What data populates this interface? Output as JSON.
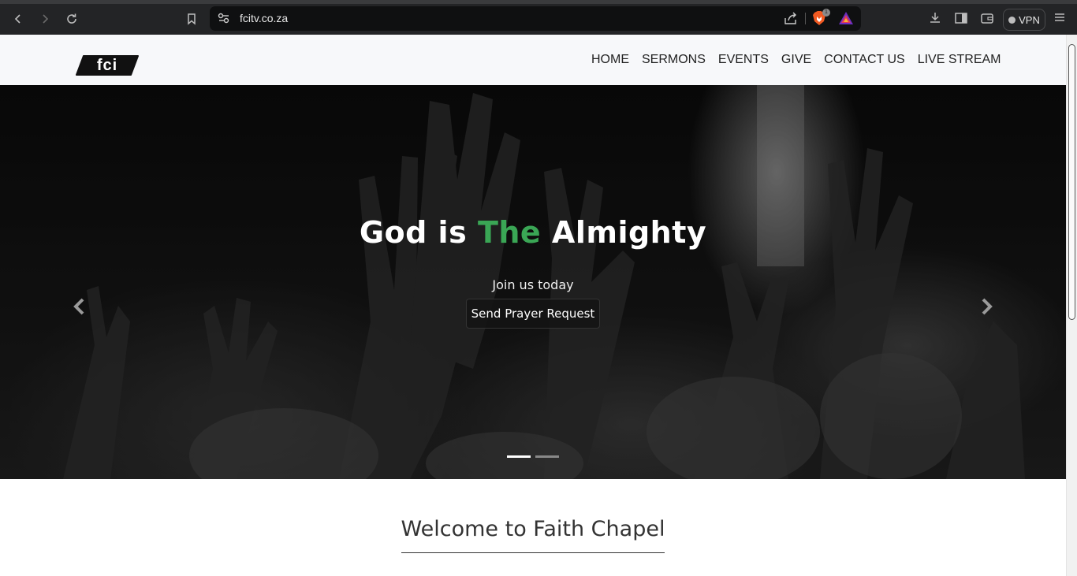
{
  "browser": {
    "url": "fcitv.co.za",
    "brave_badge": "1",
    "vpn_label": "VPN"
  },
  "site": {
    "logo_text": "fci",
    "menu": [
      {
        "label": "HOME"
      },
      {
        "label": "SERMONS"
      },
      {
        "label": "EVENTS"
      },
      {
        "label": "GIVE"
      },
      {
        "label": "CONTACT US"
      },
      {
        "label": "LIVE STREAM"
      }
    ]
  },
  "hero": {
    "title_part1": "God is ",
    "title_accent": "The",
    "title_part2": " Almighty",
    "subtitle": "Join us today",
    "button_label": "Send Prayer Request",
    "slides_total": 2,
    "active_slide": 1
  },
  "welcome": {
    "heading": "Welcome to Faith Chapel"
  },
  "colors": {
    "accent": "#3aa655",
    "chrome_bg": "#232426",
    "nav_bg": "#f7f8fa"
  }
}
